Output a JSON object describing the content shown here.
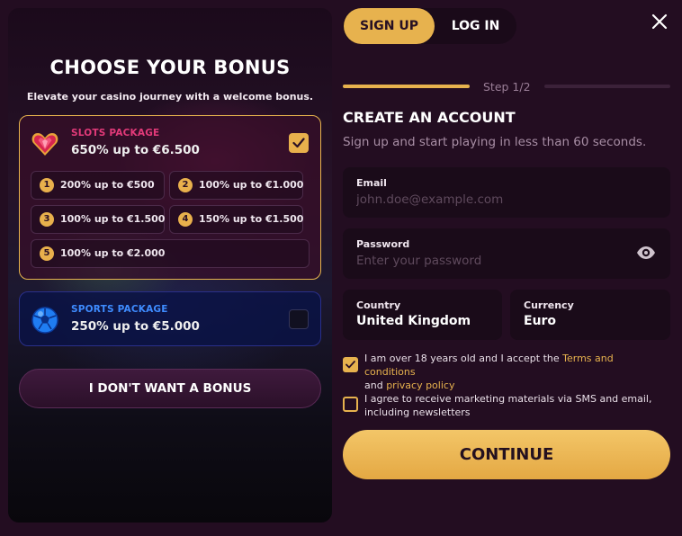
{
  "bonus": {
    "title": "CHOOSE YOUR BONUS",
    "subtitle": "Elevate your casino journey with a welcome bonus.",
    "slots_package": {
      "label": "SLOTS PACKAGE",
      "value": "650% up to €6.500",
      "selected": true,
      "icon": "heart-gem-icon",
      "offers": [
        {
          "num": "1",
          "text": "200% up to €500"
        },
        {
          "num": "2",
          "text": "100% up to €1.000"
        },
        {
          "num": "3",
          "text": "100% up to €1.500"
        },
        {
          "num": "4",
          "text": "150% up to €1.500"
        },
        {
          "num": "5",
          "text": "100% up to €2.000"
        }
      ]
    },
    "sports_package": {
      "label": "SPORTS PACKAGE",
      "value": "250% up to €5.000",
      "selected": false,
      "icon": "soccer-ball-icon"
    },
    "no_bonus_label": "I DON'T WANT A BONUS"
  },
  "auth": {
    "tabs": [
      {
        "label": "SIGN UP",
        "active": true
      },
      {
        "label": "LOG IN",
        "active": false
      }
    ],
    "step_label": "Step 1/2",
    "step_progress": 0.5,
    "title": "CREATE AN ACCOUNT",
    "subtitle": "Sign up and start playing in less than 60 seconds.",
    "email": {
      "label": "Email",
      "placeholder": "john.doe@example.com",
      "value": ""
    },
    "password": {
      "label": "Password",
      "placeholder": "Enter your password",
      "value": ""
    },
    "country": {
      "label": "Country",
      "value": "United Kingdom"
    },
    "currency": {
      "label": "Currency",
      "value": "Euro"
    },
    "terms": {
      "checked": true,
      "text_before": "I am over 18 years old and I accept the ",
      "link1": "Terms and conditions",
      "text_mid": "and ",
      "link2": "privacy policy"
    },
    "marketing": {
      "checked": false,
      "text": "I agree to receive marketing materials via SMS and email, including newsletters"
    },
    "continue_label": "CONTINUE"
  },
  "colors": {
    "accent": "#e7b24e",
    "background": "#230d21",
    "slots_label": "#e23a79",
    "sports_label": "#3e8cff"
  }
}
